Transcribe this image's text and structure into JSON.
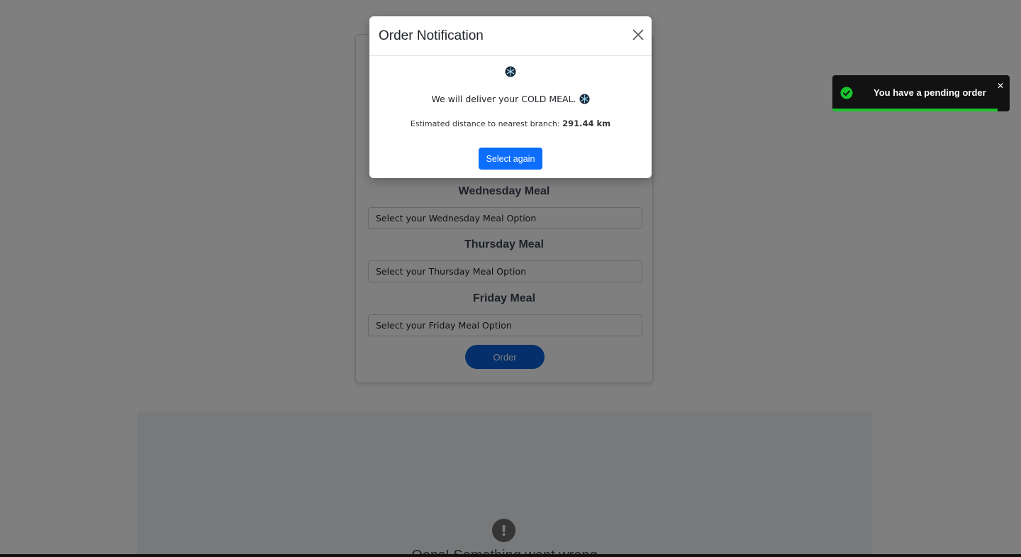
{
  "meal_form": {
    "days": [
      {
        "heading": "Wednesday Meal",
        "placeholder": "Select your Wednesday Meal Option"
      },
      {
        "heading": "Thursday Meal",
        "placeholder": "Select your Thursday Meal Option"
      },
      {
        "heading": "Friday Meal",
        "placeholder": "Select your Friday Meal Option"
      }
    ],
    "order_label": "Order"
  },
  "error_panel": {
    "message": "Oops! Something went wrong"
  },
  "modal": {
    "title": "Order Notification",
    "icon": "snowflake-icon",
    "delivery_text": "We will deliver your COLD MEAL.",
    "distance_label": "Estimated distance to nearest branch:",
    "distance_value": "291.44 km",
    "select_again_label": "Select again"
  },
  "toast": {
    "message": "You have a pending order",
    "progress_fraction": 0.93,
    "progress_color": "#19c52c"
  },
  "colors": {
    "primary": "#0d6efd",
    "order_button": "#0b5ed7",
    "toast_bg": "#121212"
  }
}
